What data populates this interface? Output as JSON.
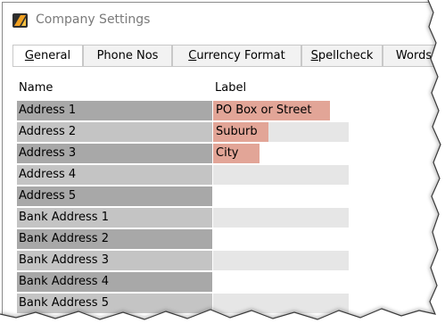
{
  "window": {
    "title": "Company Settings",
    "icon": "app-logo-icon"
  },
  "tabs": [
    {
      "label": "General",
      "underline": "G",
      "active": true
    },
    {
      "label": "Phone Nos",
      "underline": "",
      "active": false
    },
    {
      "label": "Currency Format",
      "underline": "C",
      "active": false
    },
    {
      "label": "Spellcheck",
      "underline": "S",
      "active": false
    },
    {
      "label": "Words",
      "underline": "",
      "active": false
    }
  ],
  "grid": {
    "headers": {
      "name": "Name",
      "label": "Label"
    },
    "rows": [
      {
        "name": "Address 1",
        "label": "PO Box or Street"
      },
      {
        "name": "Address 2",
        "label": "Suburb"
      },
      {
        "name": "Address 3",
        "label": "City"
      },
      {
        "name": "Address 4",
        "label": ""
      },
      {
        "name": "Address 5",
        "label": ""
      },
      {
        "name": "Bank Address 1",
        "label": ""
      },
      {
        "name": "Bank Address 2",
        "label": ""
      },
      {
        "name": "Bank Address 3",
        "label": ""
      },
      {
        "name": "Bank Address 4",
        "label": ""
      },
      {
        "name": "Bank Address 5",
        "label": ""
      }
    ]
  },
  "colors": {
    "highlight": "#e2a597",
    "name_dark": "#a8a8a8",
    "name_light": "#c4c4c4"
  }
}
